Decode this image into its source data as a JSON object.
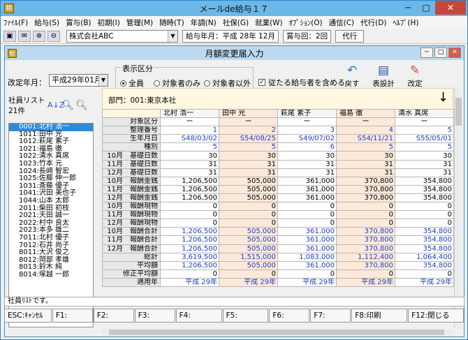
{
  "window": {
    "title": "メールde給与１７"
  },
  "menu": [
    "ﾌｧｲﾙ(F)",
    "給与(S)",
    "賞与(B)",
    "初期(I)",
    "管理(M)",
    "随時(T)",
    "年調(N)",
    "社保(G)",
    "就業(W)",
    "ｵﾌﾟｼｮﾝ(O)",
    "通信(C)",
    "代行(D)",
    "ﾍﾙﾌﾟ(H)"
  ],
  "toolbar": {
    "company": "株式会社ABC",
    "pay_month": "給与年月：平成 28年 12月",
    "bonus_count": "賞与回：2回",
    "proxy_button": "代行"
  },
  "form": {
    "title": "月額変更届入力",
    "revision_label": "改定年月：",
    "revision_value": "平成29年01月",
    "display_group_label": "表示区分",
    "radio_all": "全員",
    "radio_target_only": "対象者のみ",
    "radio_non_target": "対象者以外",
    "include_retired": "従たる給与者を含める",
    "btn_back": "戻す",
    "btn_settings": "表設計",
    "btn_confirm": "改定"
  },
  "employee_list": {
    "title": "社員リスト",
    "count": "21件",
    "items": [
      "0001:北村 浩一",
      "1011:田中 光",
      "1012:萩尾 素子",
      "1021:福島 徹",
      "1022:清水 真席",
      "1023:竹本 元",
      "1024:長崎 智宏",
      "1025:佐藤 伸一郎",
      "1031:斎藤 優子",
      "1041:沢田 美也子",
      "1044:山本 太郎",
      "2011:柴田 初枝",
      "2021:天田 誠一",
      "2022:村中 良太",
      "2023:本多 雄二",
      "7011:北村 優子",
      "7012:石井 尚子",
      "8011:大沢 俊之",
      "8012:岡部 孝雄",
      "8013:鈴木 純",
      "8014:塚越 一郎"
    ]
  },
  "grid": {
    "dept": "部門：001:東京本社",
    "columns": [
      "北村 浩一",
      "田中 光",
      "萩尾 素子",
      "福島 徹",
      "清水 真席"
    ],
    "rows": [
      {
        "label": "対象区分",
        "values": [
          "ー",
          "ー",
          "ー",
          "ー",
          "ー"
        ],
        "center": true
      },
      {
        "label": "整理番号",
        "values": [
          "1",
          "2",
          "3",
          "4",
          "5"
        ],
        "blue": true
      },
      {
        "label": "生年月日",
        "values": [
          "S48/03/02",
          "S54/08/25",
          "S49/07/02",
          "S54/11/21",
          "S55/05/01"
        ],
        "blue": true
      },
      {
        "label": "種別",
        "values": [
          "5",
          "5",
          "6",
          "5",
          "5"
        ],
        "blue": true
      },
      {
        "label": "10月　基礎日数",
        "values": [
          "30",
          "30",
          "30",
          "30",
          "30"
        ]
      },
      {
        "label": "11月　基礎日数",
        "values": [
          "31",
          "31",
          "31",
          "31",
          "31"
        ]
      },
      {
        "label": "12月　基礎日数",
        "values": [
          "31",
          "31",
          "31",
          "31",
          "31"
        ]
      },
      {
        "label": "10月　報酬金銭",
        "values": [
          "1,206,500",
          "505,000",
          "361,000",
          "370,800",
          "354,800"
        ]
      },
      {
        "label": "11月　報酬金銭",
        "values": [
          "1,206,500",
          "505,000",
          "361,000",
          "370,800",
          "354,800"
        ]
      },
      {
        "label": "12月　報酬金銭",
        "values": [
          "1,206,500",
          "505,000",
          "361,000",
          "370,800",
          "354,800"
        ]
      },
      {
        "label": "10月　報酬現物",
        "values": [
          "0",
          "0",
          "0",
          "0",
          "0"
        ]
      },
      {
        "label": "11月　報酬現物",
        "values": [
          "0",
          "0",
          "0",
          "0",
          "0"
        ]
      },
      {
        "label": "12月　報酬現物",
        "values": [
          "0",
          "0",
          "0",
          "0",
          "0"
        ]
      },
      {
        "label": "10月　報酬合計",
        "values": [
          "1,206,500",
          "505,000",
          "361,000",
          "370,800",
          "354,800"
        ],
        "blue": true
      },
      {
        "label": "11月　報酬合計",
        "values": [
          "1,206,500",
          "505,000",
          "361,000",
          "370,800",
          "354,800"
        ],
        "blue": true
      },
      {
        "label": "12月　報酬合計",
        "values": [
          "1,206,500",
          "505,000",
          "361,000",
          "370,800",
          "354,800"
        ],
        "blue": true
      },
      {
        "label": "総計",
        "values": [
          "3,619,500",
          "1,515,000",
          "1,083,000",
          "1,112,400",
          "1,064,400"
        ],
        "blue": true
      },
      {
        "label": "平均額",
        "values": [
          "1,206,500",
          "505,000",
          "361,000",
          "370,800",
          "354,800"
        ],
        "blue": true
      },
      {
        "label": "修正平均額",
        "values": [
          "0",
          "0",
          "0",
          "0",
          "0"
        ]
      },
      {
        "label": "適用年",
        "values": [
          "平成 29年",
          "平成 29年",
          "平成 29年",
          "平成 29年",
          "平成 29年"
        ],
        "blue": true
      }
    ]
  },
  "status_text": "社員ﾘｽﾄです。",
  "fkeys": [
    "ESC:ｷｬﾝｾﾙ",
    "F1:",
    "F2:",
    "F3:",
    "F4:",
    "F5:",
    "F6:",
    "F7:",
    "F8:印刷",
    "F12:閉じる"
  ]
}
